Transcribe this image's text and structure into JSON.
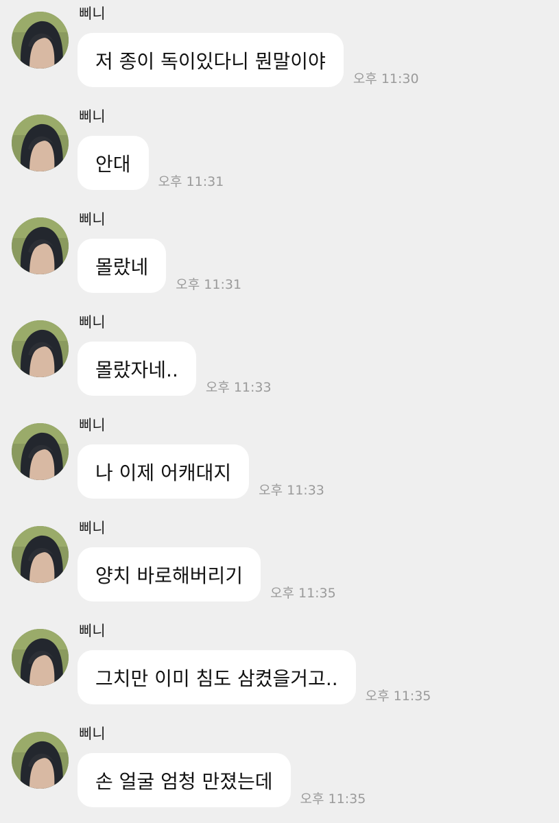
{
  "messages": [
    {
      "sender": "삐니",
      "text": "저 종이 독이있다니 뭔말이야",
      "time": "오후 11:30"
    },
    {
      "sender": "삐니",
      "text": "안대",
      "time": "오후 11:31"
    },
    {
      "sender": "삐니",
      "text": "몰랐네",
      "time": "오후 11:31"
    },
    {
      "sender": "삐니",
      "text": "몰랐자네..",
      "time": "오후 11:33"
    },
    {
      "sender": "삐니",
      "text": "나 이제 어캐대지",
      "time": "오후 11:33"
    },
    {
      "sender": "삐니",
      "text": "양치 바로해버리기",
      "time": "오후 11:35"
    },
    {
      "sender": "삐니",
      "text": "그치만 이미 침도 삼켰을거고..",
      "time": "오후 11:35"
    },
    {
      "sender": "삐니",
      "text": "손 얼굴 엄청 만졌는데",
      "time": "오후 11:35"
    }
  ]
}
